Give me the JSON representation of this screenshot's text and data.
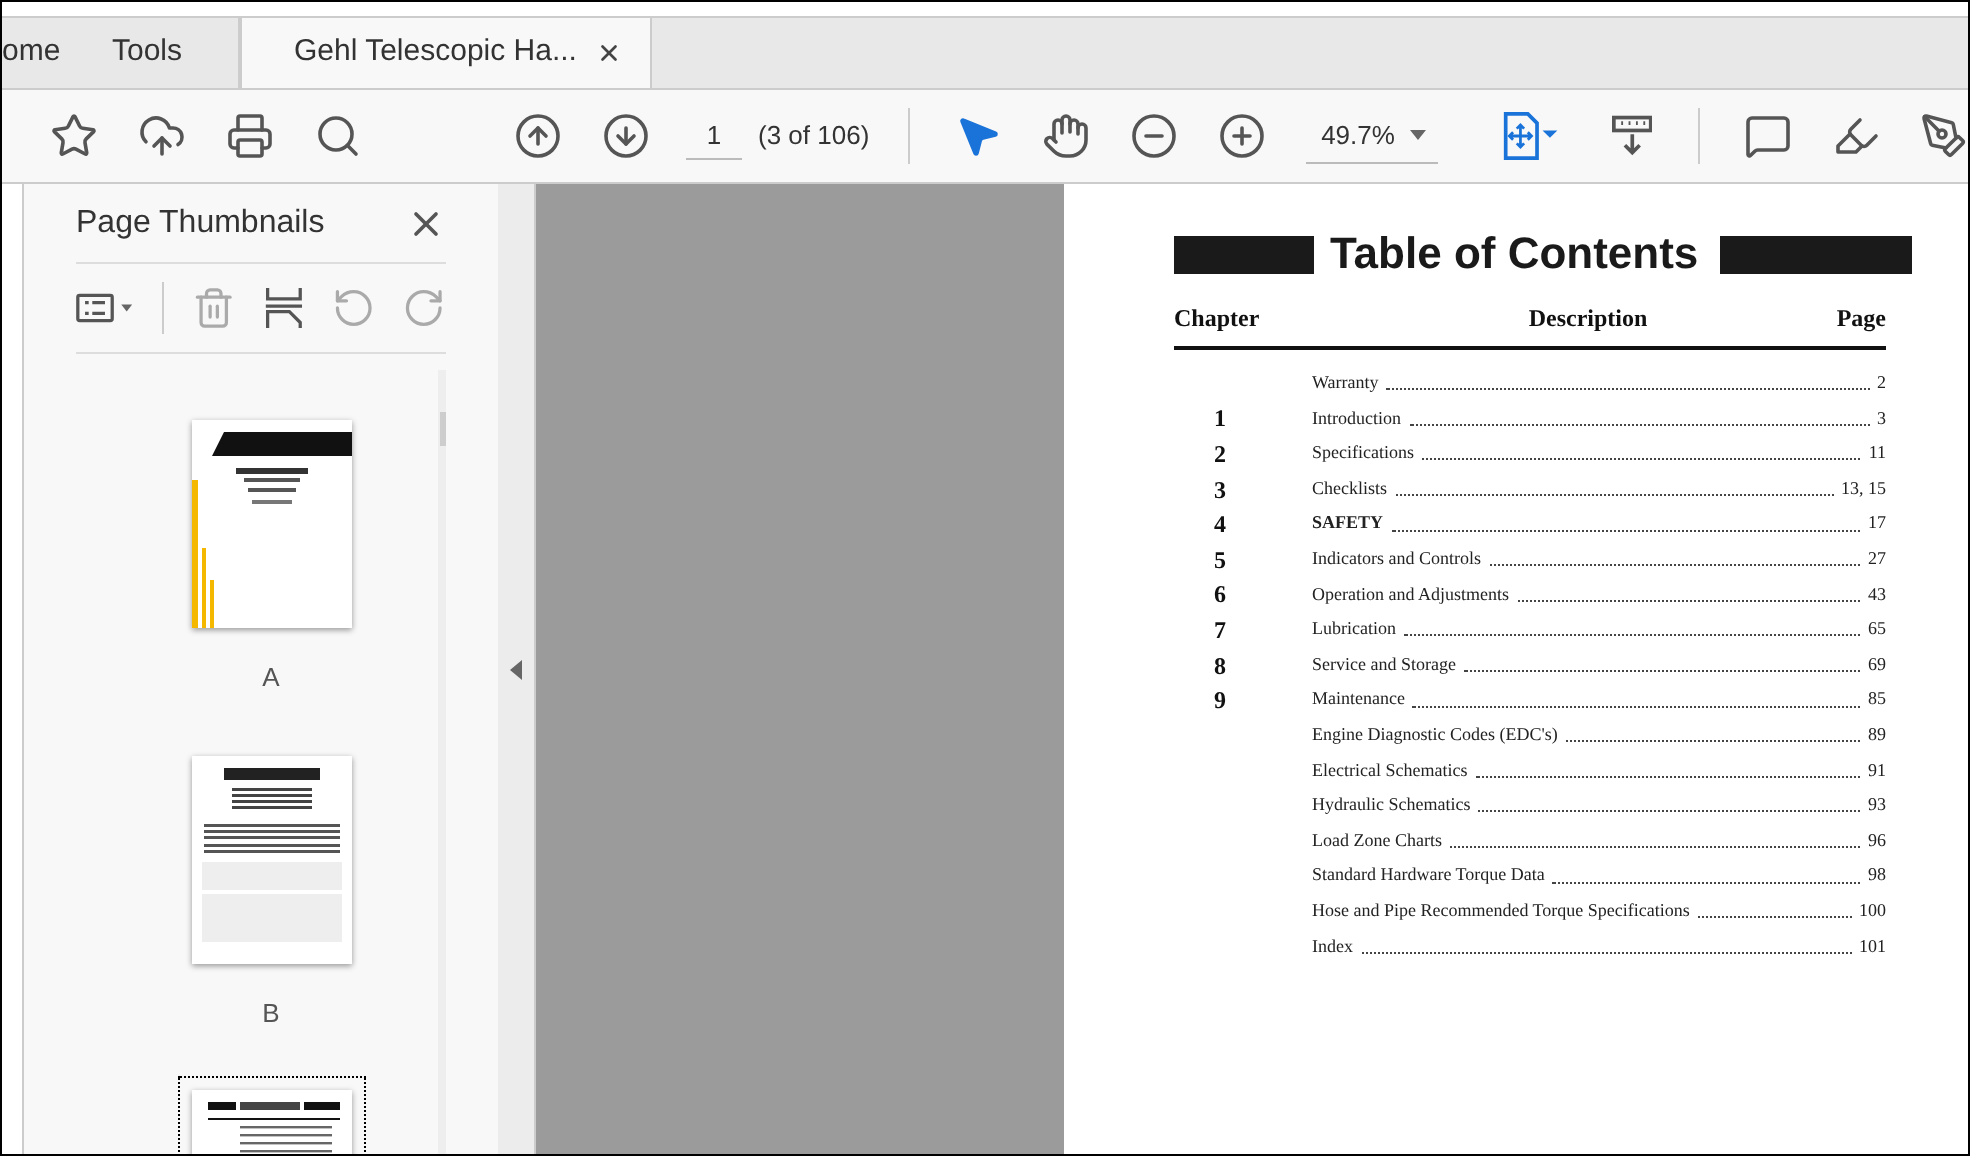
{
  "tabs": [
    {
      "label": "ome",
      "selected": false
    },
    {
      "label": "Tools",
      "selected": false
    },
    {
      "label": "Gehl Telescopic Ha...",
      "selected": true
    }
  ],
  "toolbar": {
    "page_number": "1",
    "page_count": "(3 of 106)",
    "zoom": "49.7%",
    "tools": [
      {
        "kind": "pointer",
        "selected": true
      },
      {
        "kind": "hand",
        "selected": false
      }
    ]
  },
  "sidebar": {
    "title": "Page Thumbnails",
    "thumbnails": [
      {
        "kind": "cover",
        "label": "A",
        "selected": false
      },
      {
        "kind": "warning",
        "label": "B",
        "selected": false
      },
      {
        "kind": "contents",
        "selected": true
      }
    ]
  },
  "document": {
    "title": "Table of Contents",
    "columns": [
      "Chapter",
      "Description",
      "Page"
    ],
    "entries": [
      {
        "title": "Warranty",
        "page": "2",
        "emphasis": false
      },
      {
        "chapter": "1",
        "title": "Introduction",
        "page": "3",
        "emphasis": false
      },
      {
        "chapter": "2",
        "title": "Specifications",
        "page": "11",
        "emphasis": false
      },
      {
        "chapter": "3",
        "title": "Checklists",
        "page": "13, 15",
        "emphasis": false
      },
      {
        "chapter": "4",
        "title": "SAFETY",
        "page": "17",
        "emphasis": true
      },
      {
        "chapter": "5",
        "title": "Indicators and Controls",
        "page": "27",
        "emphasis": false
      },
      {
        "chapter": "6",
        "title": "Operation and Adjustments",
        "page": "43",
        "emphasis": false
      },
      {
        "chapter": "7",
        "title": "Lubrication",
        "page": "65",
        "emphasis": false
      },
      {
        "chapter": "8",
        "title": "Service and Storage",
        "page": "69",
        "emphasis": false
      },
      {
        "chapter": "9",
        "title": "Maintenance",
        "page": "85",
        "emphasis": false
      },
      {
        "title": "Engine Diagnostic Codes (EDC's)",
        "page": "89",
        "emphasis": false
      },
      {
        "title": "Electrical Schematics",
        "page": "91",
        "emphasis": false
      },
      {
        "title": "Hydraulic Schematics",
        "page": "93",
        "emphasis": false
      },
      {
        "title": "Load Zone Charts",
        "page": "96",
        "emphasis": false
      },
      {
        "title": "Standard Hardware Torque Data",
        "page": "98",
        "emphasis": false
      },
      {
        "title": "Hose and Pipe Recommended Torque Specifications",
        "page": "100",
        "emphasis": false
      },
      {
        "title": "Index",
        "page": "101",
        "emphasis": false
      }
    ]
  }
}
